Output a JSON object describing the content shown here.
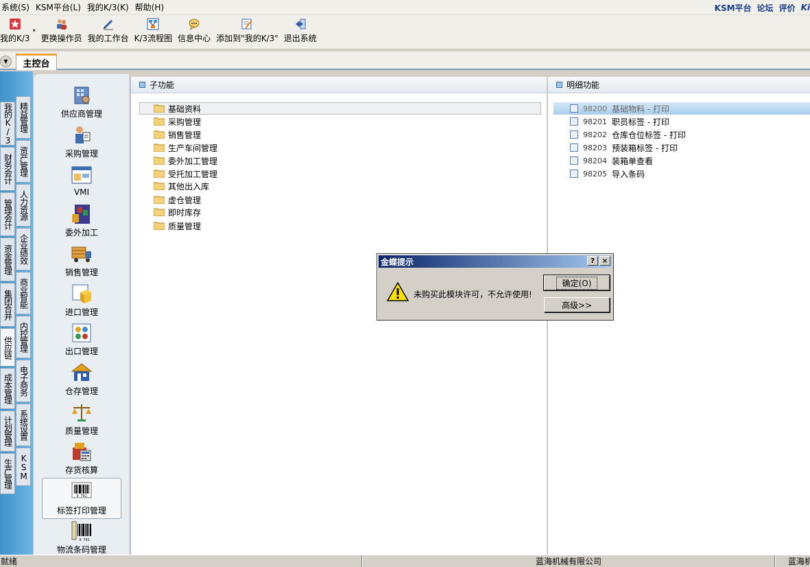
{
  "menu": {
    "items": [
      "系统(S)",
      "KSM平台(L)",
      "我的K/3(K)",
      "帮助(H)"
    ],
    "right_links": [
      "KSM平台",
      "论坛",
      "评价"
    ],
    "right_cut": "Ki"
  },
  "toolbar": {
    "items": [
      {
        "label": "我的K/3",
        "icon": "star-icon"
      },
      {
        "label": "更换操作员",
        "icon": "users-icon"
      },
      {
        "label": "我的工作台",
        "icon": "pen-icon"
      },
      {
        "label": "K/3流程图",
        "icon": "flowchart-icon"
      },
      {
        "label": "信息中心",
        "icon": "chat-icon"
      },
      {
        "label": "添加到\"我的K/3\"",
        "icon": "add-note-icon"
      },
      {
        "label": "退出系统",
        "icon": "exit-icon"
      }
    ]
  },
  "tabs": {
    "main": "主控台"
  },
  "vertical_tabs": {
    "outer": [
      "我的K/3",
      "财务会计",
      "管理会计",
      "资金管理",
      "集团合并",
      "供应链",
      "成本管理",
      "计划管理",
      "生产管理"
    ],
    "inner": [
      "精益管理",
      "资产管理",
      "人力资源",
      "企业绩效",
      "商业智能",
      "内控管理",
      "电子商务",
      "系统设置",
      "KSM"
    ]
  },
  "modules": [
    {
      "label": "供应商管理",
      "icon": "supplier-icon"
    },
    {
      "label": "采购管理",
      "icon": "purchase-icon"
    },
    {
      "label": "VMI",
      "icon": "vmi-icon"
    },
    {
      "label": "委外加工",
      "icon": "outsourcing-icon"
    },
    {
      "label": "销售管理",
      "icon": "sales-truck-icon"
    },
    {
      "label": "进口管理",
      "icon": "import-box-icon"
    },
    {
      "label": "出口管理",
      "icon": "export-icon"
    },
    {
      "label": "仓存管理",
      "icon": "warehouse-icon"
    },
    {
      "label": "质量管理",
      "icon": "quality-scale-icon"
    },
    {
      "label": "存货核算",
      "icon": "inventory-calc-icon"
    },
    {
      "label": "标签打印管理",
      "icon": "barcode-label-icon"
    },
    {
      "label": "物流条码管理",
      "icon": "barcode-scanner-icon"
    }
  ],
  "sub_panel": {
    "title": "子功能",
    "folders": [
      "基础资料",
      "采购管理",
      "销售管理",
      "生产车间管理",
      "委外加工管理",
      "受托加工管理",
      "其他出入库",
      "虚仓管理",
      "即时库存",
      "质量管理"
    ]
  },
  "detail_panel": {
    "title": "明细功能",
    "items": [
      {
        "code": "98200",
        "label": "基础物料 - 打印"
      },
      {
        "code": "98201",
        "label": "职员标签 - 打印"
      },
      {
        "code": "98202",
        "label": "仓库仓位标签 - 打印"
      },
      {
        "code": "98203",
        "label": "预装箱标签 - 打印"
      },
      {
        "code": "98204",
        "label": "装箱单查看"
      },
      {
        "code": "98205",
        "label": "导入条码"
      }
    ]
  },
  "dialog": {
    "title": "金蝶提示",
    "help": "?",
    "close": "×",
    "message": "未购买此模块许可，不允许使用!",
    "ok_label": "确定(O)",
    "advanced_label": "高级>>"
  },
  "status": {
    "left": "就绪",
    "company": "蓝海机械有限公司",
    "right": "蓝海机"
  }
}
